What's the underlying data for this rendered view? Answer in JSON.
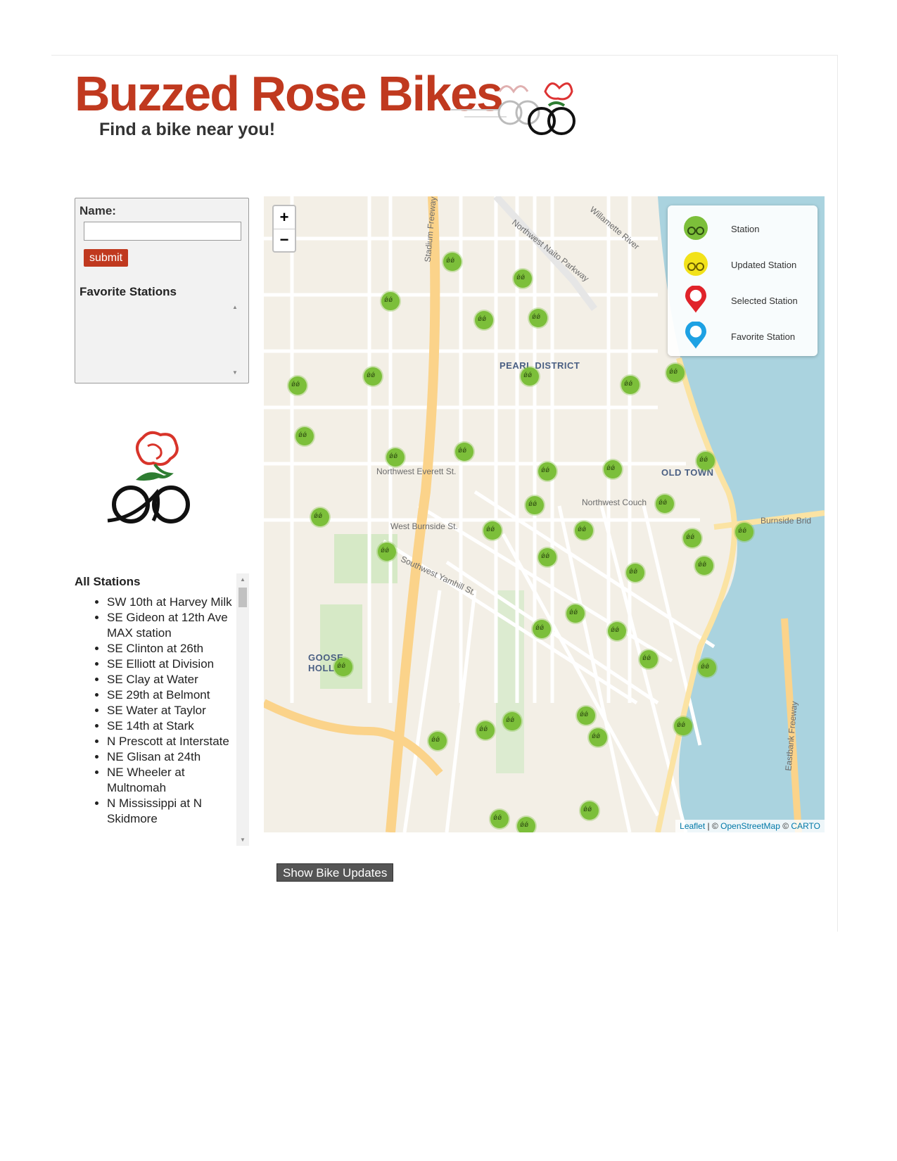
{
  "header": {
    "title": "Buzzed Rose Bikes",
    "tagline": "Find a bike near you!"
  },
  "form": {
    "name_label": "Name:",
    "name_value": "",
    "submit_label": "submit",
    "favorites_title": "Favorite Stations"
  },
  "stations": {
    "title": "All Stations",
    "items": [
      "SW 10th at Harvey Milk",
      "SE Gideon at 12th Ave MAX station",
      "SE Clinton at 26th",
      "SE Elliott at Division",
      "SE Clay at Water",
      "SE 29th at Belmont",
      "SE Water at Taylor",
      "SE 14th at Stark",
      "N Prescott at Interstate",
      "NE Glisan at 24th",
      "NE Wheeler at Multnomah",
      "N Mississippi at N Skidmore"
    ]
  },
  "map": {
    "zoom_in": "+",
    "zoom_out": "−",
    "legend": [
      {
        "label": "Station",
        "icon": "green-station-icon",
        "color": "#7cbf3a"
      },
      {
        "label": "Updated Station",
        "icon": "yellow-station-icon",
        "color": "#f2e21a"
      },
      {
        "label": "Selected Station",
        "icon": "red-pin-icon",
        "color": "#e0232a"
      },
      {
        "label": "Favorite Station",
        "icon": "blue-pin-icon",
        "color": "#1ea1e3"
      }
    ],
    "attribution": {
      "leaflet": "Leaflet",
      "separator": "| ©",
      "osm": "OpenStreetMap",
      "copy": "©",
      "carto": "CARTO"
    },
    "labels": {
      "pearl": "PEARL DISTRICT",
      "old_town": "OLD TOWN",
      "goose_hollow": "GOOSE HOLLOW",
      "everett": "Northwest Everett St.",
      "burnside": "West Burnside St.",
      "burnside_bridge": "Burnside Brid",
      "naito": "Northwest Naito Parkway",
      "willamette": "Willamette River",
      "stadium": "Stadium Freeway",
      "couch": "Northwest Couch",
      "yamhill": "Southwest Yamhill St.",
      "eastbank": "Eastbank Freeway"
    }
  },
  "updates_button": "Show Bike Updates",
  "colors": {
    "brand": "#c0391f",
    "station": "#7cbf3a",
    "river": "#aad3df"
  }
}
